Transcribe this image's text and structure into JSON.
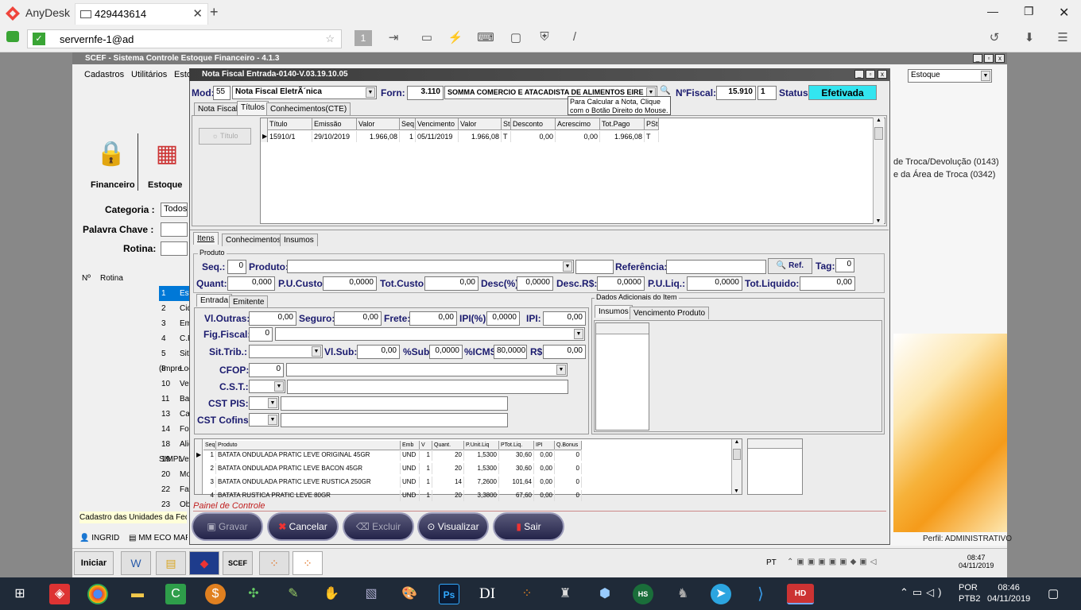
{
  "anydesk": {
    "app_name": "AnyDesk",
    "tab_label": "429443614",
    "address": "servernfe-1@ad",
    "display_number": "1"
  },
  "scef": {
    "title": "SCEF - Sistema Controle Estoque Financeiro - 4.1.3",
    "menu": [
      "Cadastros",
      "Utilitários",
      "Esto"
    ],
    "modules": [
      "Financeiro",
      "Estoque"
    ],
    "categoria_label": "Categoria :",
    "categoria_value": "Todos",
    "palavra_label": "Palavra Chave :",
    "rotina_label": "Rotina:",
    "list_header": {
      "n": "Nº",
      "rotina": "Rotina"
    },
    "list": [
      {
        "n": "1",
        "rotina": "Estado"
      },
      {
        "n": "2",
        "rotina": "Cidade"
      },
      {
        "n": "3",
        "rotina": "Embalagens"
      },
      {
        "n": "4",
        "rotina": "C.F.O.P."
      },
      {
        "n": "5",
        "rotina": "Situação Tributária (Impre"
      },
      {
        "n": "8",
        "rotina": "Local"
      },
      {
        "n": "10",
        "rotina": "Vendedor"
      },
      {
        "n": "11",
        "rotina": "Bairro"
      },
      {
        "n": "13",
        "rotina": "Cadastro de Produtos"
      },
      {
        "n": "14",
        "rotina": "Fornecedor"
      },
      {
        "n": "18",
        "rotina": "Aliquota Mensal do SIMPL"
      },
      {
        "n": "19",
        "rotina": "Veículo"
      },
      {
        "n": "20",
        "rotina": "Motivo"
      },
      {
        "n": "22",
        "rotina": "Família"
      },
      {
        "n": "23",
        "rotina": "Observação"
      }
    ],
    "status_line": "Cadastro das Unidades da Fede",
    "user": "INGRID",
    "company": "MM ECO MAR",
    "right_combo": "Estoque",
    "right_items": [
      "de Troca/Devolução (0143)",
      "e da Área de Troca (0342)"
    ],
    "perfil": "Perfil: ADMINISTRATIVO"
  },
  "nf": {
    "title": "Nota Fiscal Entrada-0140-V.03.19.10.05",
    "mod_label": "Mod:",
    "mod_value": "55",
    "mod_desc": "Nota Fiscal EletrÃ´nica",
    "forn_label": "Forn:",
    "forn_code": "3.110",
    "forn_name": "SOMMA COMERCIO E ATACADISTA DE ALIMENTOS EIRE",
    "nfiscal_label": "NºFiscal:",
    "nfiscal_value": "15.910",
    "serie": "1",
    "status_label": "Status:",
    "status_value": "Efetivada",
    "tooltip": [
      "Para Calcular a Nota, Clique",
      "com o Botão Direito do Mouse."
    ],
    "tabs_top": [
      "Nota Fiscal",
      "Títulos",
      "Conhecimentos(CTE)"
    ],
    "titulo_btn": "Título",
    "titulos_headers": [
      "Título",
      "Emissão",
      "Valor",
      "Seq",
      "Vencimento",
      "Valor",
      "St",
      "Desconto",
      "Acrescimo",
      "Tot.Pago",
      "PSt"
    ],
    "titulos_rows": [
      [
        "15910/1",
        "29/10/2019",
        "1.966,08",
        "1",
        "05/11/2019",
        "1.966,08",
        "T",
        "0,00",
        "0,00",
        "1.966,08",
        "T"
      ]
    ],
    "tabs_mid": [
      "Itens",
      "Conhecimentos",
      "Insumos"
    ],
    "produto_group": "Produto",
    "seq_label": "Seq.:",
    "seq_value": "0",
    "produto_label": "Produto:",
    "referencia_label": "Referência:",
    "ref_btn": "Ref.",
    "tag_label": "Tag:",
    "tag_value": "0",
    "quant_label": "Quant:",
    "quant_value": "0,000",
    "pucusto_label": "P.U.Custo:",
    "pucusto_value": "0,0000",
    "totcusto_label": "Tot.Custo:",
    "totcusto_value": "0,00",
    "desc_label": "Desc(%)",
    "desc_value": "0,0000",
    "descrs_label": "Desc.R$:",
    "descrs_value": "0,0000",
    "puliq_label": "P.U.Liq.:",
    "puliq_value": "0,0000",
    "totliq_label": "Tot.Liquido:",
    "totliq_value": "0,00",
    "tabs_ent": [
      "Entrada",
      "Emitente"
    ],
    "vloutras_label": "Vl.Outras:",
    "vloutras_value": "0,00",
    "seguro_label": "Seguro:",
    "seguro_value": "0,00",
    "frete_label": "Frete:",
    "frete_value": "0,00",
    "ipiperc_label": "IPI(%)",
    "ipiperc_value": "0,0000",
    "ipi_label": "IPI:",
    "ipi_value": "0,00",
    "figfiscal_label": "Fig.Fiscal:",
    "figfiscal_value": "0",
    "sittrib_label": "Sit.Trib.:",
    "vlsub_label": "Vl.Sub:",
    "vlsub_value": "0,00",
    "psub_label": "%Sub",
    "psub_value": "0,0000",
    "picms_label": "%ICMS",
    "picms_value": "80,0000",
    "rs_label": "R$",
    "rs_value": "0,00",
    "cfop_label": "CFOP:",
    "cfop_value": "0",
    "cst_label": "C.S.T.:",
    "cstpis_label": "CST PIS:",
    "cstcofins_label": "CST Cofins:",
    "dados_group": "Dados Adicionais do Item",
    "tabs_dados": [
      "Insumos",
      "Vencimento Produto"
    ],
    "itens_headers": [
      "Seq",
      "Produto",
      "Emb",
      "V",
      "Quant.",
      "P.Unit.Liq",
      "PTot.Liq.",
      "IPI",
      "Q.Bonus"
    ],
    "itens_rows": [
      [
        "1",
        "BATATA ONDULADA PRATIC LEVE ORIGINAL 45GR",
        "UND",
        "1",
        "20",
        "1,5300",
        "30,60",
        "0,00",
        "0"
      ],
      [
        "2",
        "BATATA ONDULADA PRATIC LEVE BACON 45GR",
        "UND",
        "1",
        "20",
        "1,5300",
        "30,60",
        "0,00",
        "0"
      ],
      [
        "3",
        "BATATA ONDULADA PRATIC LEVE RUSTICA 250GR",
        "UND",
        "1",
        "14",
        "7,2600",
        "101,64",
        "0,00",
        "0"
      ],
      [
        "4",
        "BATATA RUSTICA PRATIC LEVE 80GR",
        "UND",
        "1",
        "20",
        "3,3800",
        "67,60",
        "0,00",
        "0"
      ]
    ],
    "painel_label": "Painel de Controle",
    "buttons": [
      "Gravar",
      "Cancelar",
      "Excluir",
      "Visualizar",
      "Sair"
    ]
  },
  "xp_taskbar": {
    "start": "Iniciar",
    "lang": "PT",
    "time": "08:47",
    "date": "04/11/2019"
  },
  "win10": {
    "lang": "POR",
    "layout": "PTB2",
    "time": "08:46",
    "date": "04/11/2019"
  },
  "colors": {
    "status_bg": "#33e5f0",
    "selection": "#0078d7",
    "panel_label": "#c02020"
  }
}
